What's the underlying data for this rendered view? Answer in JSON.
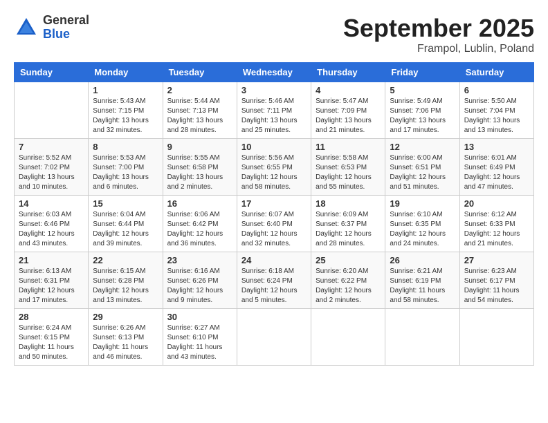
{
  "header": {
    "logo": {
      "general": "General",
      "blue": "Blue"
    },
    "month": "September 2025",
    "location": "Frampol, Lublin, Poland"
  },
  "days_of_week": [
    "Sunday",
    "Monday",
    "Tuesday",
    "Wednesday",
    "Thursday",
    "Friday",
    "Saturday"
  ],
  "weeks": [
    [
      {
        "num": "",
        "info": ""
      },
      {
        "num": "1",
        "info": "Sunrise: 5:43 AM\nSunset: 7:15 PM\nDaylight: 13 hours\nand 32 minutes."
      },
      {
        "num": "2",
        "info": "Sunrise: 5:44 AM\nSunset: 7:13 PM\nDaylight: 13 hours\nand 28 minutes."
      },
      {
        "num": "3",
        "info": "Sunrise: 5:46 AM\nSunset: 7:11 PM\nDaylight: 13 hours\nand 25 minutes."
      },
      {
        "num": "4",
        "info": "Sunrise: 5:47 AM\nSunset: 7:09 PM\nDaylight: 13 hours\nand 21 minutes."
      },
      {
        "num": "5",
        "info": "Sunrise: 5:49 AM\nSunset: 7:06 PM\nDaylight: 13 hours\nand 17 minutes."
      },
      {
        "num": "6",
        "info": "Sunrise: 5:50 AM\nSunset: 7:04 PM\nDaylight: 13 hours\nand 13 minutes."
      }
    ],
    [
      {
        "num": "7",
        "info": "Sunrise: 5:52 AM\nSunset: 7:02 PM\nDaylight: 13 hours\nand 10 minutes."
      },
      {
        "num": "8",
        "info": "Sunrise: 5:53 AM\nSunset: 7:00 PM\nDaylight: 13 hours\nand 6 minutes."
      },
      {
        "num": "9",
        "info": "Sunrise: 5:55 AM\nSunset: 6:58 PM\nDaylight: 13 hours\nand 2 minutes."
      },
      {
        "num": "10",
        "info": "Sunrise: 5:56 AM\nSunset: 6:55 PM\nDaylight: 12 hours\nand 58 minutes."
      },
      {
        "num": "11",
        "info": "Sunrise: 5:58 AM\nSunset: 6:53 PM\nDaylight: 12 hours\nand 55 minutes."
      },
      {
        "num": "12",
        "info": "Sunrise: 6:00 AM\nSunset: 6:51 PM\nDaylight: 12 hours\nand 51 minutes."
      },
      {
        "num": "13",
        "info": "Sunrise: 6:01 AM\nSunset: 6:49 PM\nDaylight: 12 hours\nand 47 minutes."
      }
    ],
    [
      {
        "num": "14",
        "info": "Sunrise: 6:03 AM\nSunset: 6:46 PM\nDaylight: 12 hours\nand 43 minutes."
      },
      {
        "num": "15",
        "info": "Sunrise: 6:04 AM\nSunset: 6:44 PM\nDaylight: 12 hours\nand 39 minutes."
      },
      {
        "num": "16",
        "info": "Sunrise: 6:06 AM\nSunset: 6:42 PM\nDaylight: 12 hours\nand 36 minutes."
      },
      {
        "num": "17",
        "info": "Sunrise: 6:07 AM\nSunset: 6:40 PM\nDaylight: 12 hours\nand 32 minutes."
      },
      {
        "num": "18",
        "info": "Sunrise: 6:09 AM\nSunset: 6:37 PM\nDaylight: 12 hours\nand 28 minutes."
      },
      {
        "num": "19",
        "info": "Sunrise: 6:10 AM\nSunset: 6:35 PM\nDaylight: 12 hours\nand 24 minutes."
      },
      {
        "num": "20",
        "info": "Sunrise: 6:12 AM\nSunset: 6:33 PM\nDaylight: 12 hours\nand 21 minutes."
      }
    ],
    [
      {
        "num": "21",
        "info": "Sunrise: 6:13 AM\nSunset: 6:31 PM\nDaylight: 12 hours\nand 17 minutes."
      },
      {
        "num": "22",
        "info": "Sunrise: 6:15 AM\nSunset: 6:28 PM\nDaylight: 12 hours\nand 13 minutes."
      },
      {
        "num": "23",
        "info": "Sunrise: 6:16 AM\nSunset: 6:26 PM\nDaylight: 12 hours\nand 9 minutes."
      },
      {
        "num": "24",
        "info": "Sunrise: 6:18 AM\nSunset: 6:24 PM\nDaylight: 12 hours\nand 5 minutes."
      },
      {
        "num": "25",
        "info": "Sunrise: 6:20 AM\nSunset: 6:22 PM\nDaylight: 12 hours\nand 2 minutes."
      },
      {
        "num": "26",
        "info": "Sunrise: 6:21 AM\nSunset: 6:19 PM\nDaylight: 11 hours\nand 58 minutes."
      },
      {
        "num": "27",
        "info": "Sunrise: 6:23 AM\nSunset: 6:17 PM\nDaylight: 11 hours\nand 54 minutes."
      }
    ],
    [
      {
        "num": "28",
        "info": "Sunrise: 6:24 AM\nSunset: 6:15 PM\nDaylight: 11 hours\nand 50 minutes."
      },
      {
        "num": "29",
        "info": "Sunrise: 6:26 AM\nSunset: 6:13 PM\nDaylight: 11 hours\nand 46 minutes."
      },
      {
        "num": "30",
        "info": "Sunrise: 6:27 AM\nSunset: 6:10 PM\nDaylight: 11 hours\nand 43 minutes."
      },
      {
        "num": "",
        "info": ""
      },
      {
        "num": "",
        "info": ""
      },
      {
        "num": "",
        "info": ""
      },
      {
        "num": "",
        "info": ""
      }
    ]
  ]
}
